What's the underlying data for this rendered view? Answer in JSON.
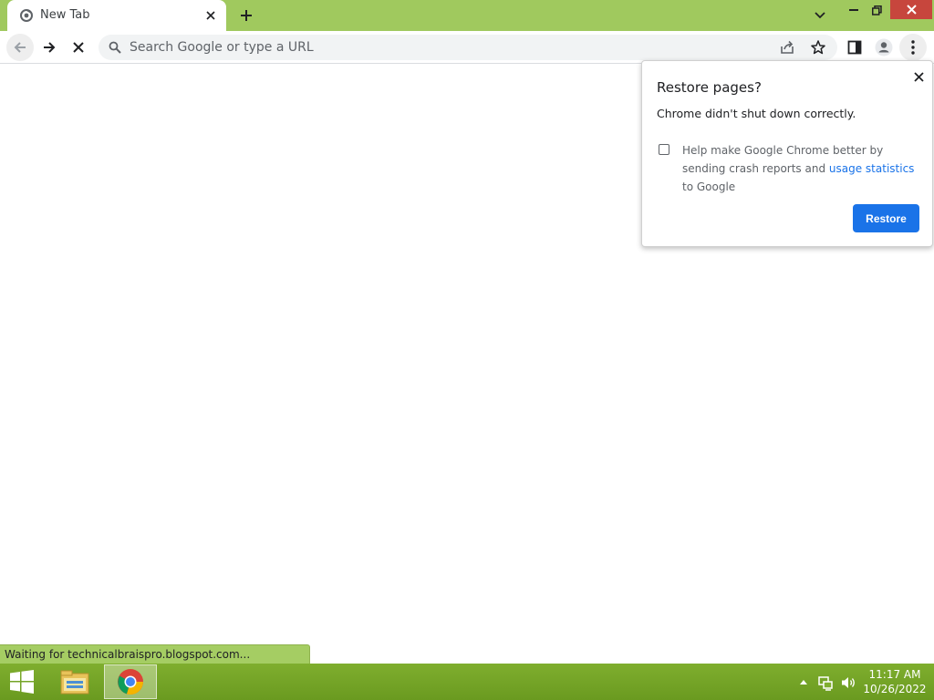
{
  "browser": {
    "tab": {
      "title": "New Tab"
    },
    "omnibox": {
      "placeholder": "Search Google or type a URL",
      "value": ""
    }
  },
  "restore_bubble": {
    "title": "Restore pages?",
    "message": "Chrome didn't shut down correctly.",
    "checkbox": {
      "checked": false,
      "label_before": "Help make Google Chrome better by sending crash reports and ",
      "link_text": "usage statistics",
      "label_after": " to Google"
    },
    "restore_label": "Restore"
  },
  "status_bar": {
    "text": "Waiting for technicalbraispro.blogspot.com..."
  },
  "taskbar": {
    "clock": {
      "time": "11:17 AM",
      "date": "10/26/2022"
    }
  },
  "colors": {
    "tabstrip": "#a0c95e",
    "taskbar": "#7fae2e",
    "accent": "#1a73e8",
    "close_red": "#c7463d"
  },
  "icons": [
    "chrome-favicon-icon",
    "close-icon",
    "plus-icon",
    "chevron-down-icon",
    "minimize-icon",
    "restore-window-icon",
    "back-arrow-icon",
    "forward-arrow-icon",
    "stop-icon",
    "search-icon",
    "share-icon",
    "star-icon",
    "side-panel-icon",
    "profile-icon",
    "more-vert-icon",
    "windows-logo-icon",
    "file-explorer-icon",
    "chrome-icon",
    "tray-up-arrow-icon",
    "network-icon",
    "volume-icon"
  ]
}
